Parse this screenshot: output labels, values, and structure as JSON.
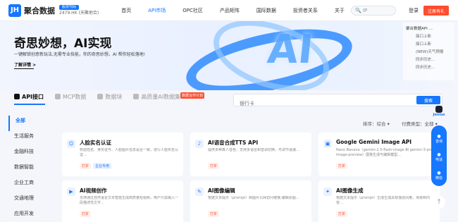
{
  "nav": {
    "logo_mark": "JH",
    "brand": "聚合数据",
    "stock_badge": "股票代码",
    "stock_code": "2479.HK (天聚地合)",
    "menu": [
      "首页",
      "API市场",
      "OPC社区",
      "产品矩阵",
      "国际数据",
      "投资者关系",
      "关于"
    ],
    "active_menu": "API市场",
    "search_placeholder": "🔍 IP",
    "login": "登录",
    "register": "注册有礼"
  },
  "hero": {
    "title": "奇思妙想，AI实现",
    "subtitle": "一键解锁创意新玩法,无需专业技能，你的奇思妙想，AI 帮你轻松落地!",
    "link": "了解详情 >",
    "news": [
      "聚合数据API …",
      "接口上新",
      "接口上新",
      "(NEW)天气预报",
      "同步历史…",
      "同步历史…"
    ]
  },
  "tabs": {
    "items": [
      "API接口",
      "MCP数据",
      "数据块",
      "高质量AI数据集"
    ],
    "tag": "数据合作计划"
  },
  "api_search": {
    "placeholder": "银行卡",
    "button": "搜索"
  },
  "sidebar": {
    "categories": [
      "全部",
      "生活服务",
      "金融科技",
      "数据智能",
      "企业工商",
      "交通地理",
      "应用开发"
    ]
  },
  "filters": {
    "sort": "排序：综合 ▾",
    "type": "付费类型：全部 ▾"
  },
  "cards": [
    {
      "title": "人脸实名认证",
      "desc": "校验姓名、身份证号、人脸图片信息是否一致，进行人脸实名认证…",
      "tags": [
        "打折",
        "企业专用"
      ]
    },
    {
      "title": "AI语音合成TTS API",
      "desc": "提供多种真人音色，支持多语言和音调切换，可调节语速…",
      "tags": [
        "打折"
      ]
    },
    {
      "title": "Google Gemini Image API",
      "desc": "Nano Banana（gemini-2.5-flash-image 和 gemini-3-pro-image-preview）图像生成与编辑模型…",
      "tags": [
        "打折"
      ]
    },
    {
      "title": "AI视频创作",
      "desc": "支持通过自然语言文本智能生成高质量短视频，用户只需输入一段描述性文字…",
      "tags": [
        "打折"
      ]
    },
    {
      "title": "AI图像编辑",
      "desc": "根据文本提示（prompt）和图片公网访问链接,编辑原图…",
      "tags": [
        "打折"
      ]
    },
    {
      "title": "AI图像生成",
      "desc": "根据文本提示（prompt）生成生成具有独创风格，场景和内容…",
      "tags": [
        "打折"
      ]
    }
  ],
  "float": {
    "mascot": "Jenius",
    "items": [
      "咨询",
      "电话",
      "微信"
    ],
    "backtop": "↑"
  }
}
